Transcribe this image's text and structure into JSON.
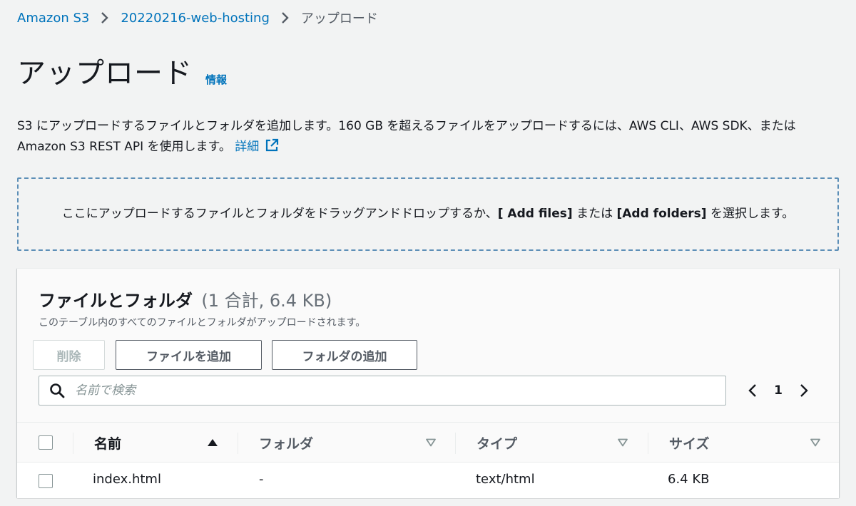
{
  "breadcrumb": {
    "items": [
      {
        "label": "Amazon S3"
      },
      {
        "label": "20220216-web-hosting"
      },
      {
        "label": "アップロード"
      }
    ]
  },
  "header": {
    "title": "アップロード",
    "info_link": "情報"
  },
  "description": {
    "text": "S3 にアップロードするファイルとフォルダを追加します。160 GB を超えるファイルをアップロードするには、AWS CLI、AWS SDK、または Amazon S3 REST API を使用します。",
    "more_link": "詳細"
  },
  "dropzone": {
    "text_before": "ここにアップロードするファイルとフォルダをドラッグアンドドロップするか、",
    "add_files": "[ Add files]",
    "text_middle": " または ",
    "add_folders": "[Add folders]",
    "text_after": " を選択します。"
  },
  "files_panel": {
    "title": "ファイルとフォルダ",
    "count": "(1 合計, 6.4 KB)",
    "subtitle": "このテーブル内のすべてのファイルとフォルダがアップロードされます。",
    "buttons": {
      "delete": "削除",
      "add_files": "ファイルを追加",
      "add_folder": "フォルダの追加"
    },
    "search": {
      "placeholder": "名前で検索",
      "value": ""
    },
    "pagination": {
      "current_page": "1"
    },
    "columns": [
      {
        "label": "名前",
        "sort": "ascending"
      },
      {
        "label": "フォルダ",
        "sort": "none"
      },
      {
        "label": "タイプ",
        "sort": "none"
      },
      {
        "label": "サイズ",
        "sort": "none"
      }
    ],
    "rows": [
      {
        "name": "index.html",
        "folder": "-",
        "type": "text/html",
        "size": "6.4 KB"
      }
    ]
  },
  "colors": {
    "link": "#0073bb",
    "page_background": "#f2f3f3",
    "dropzone_border": "#5d8fb7",
    "text": "#16191f",
    "muted_text": "#545b64"
  },
  "icons": [
    "chevron-right-icon",
    "external-link-icon",
    "search-icon",
    "chevron-left-icon",
    "sort-ascending-icon",
    "sort-unsorted-icon"
  ]
}
